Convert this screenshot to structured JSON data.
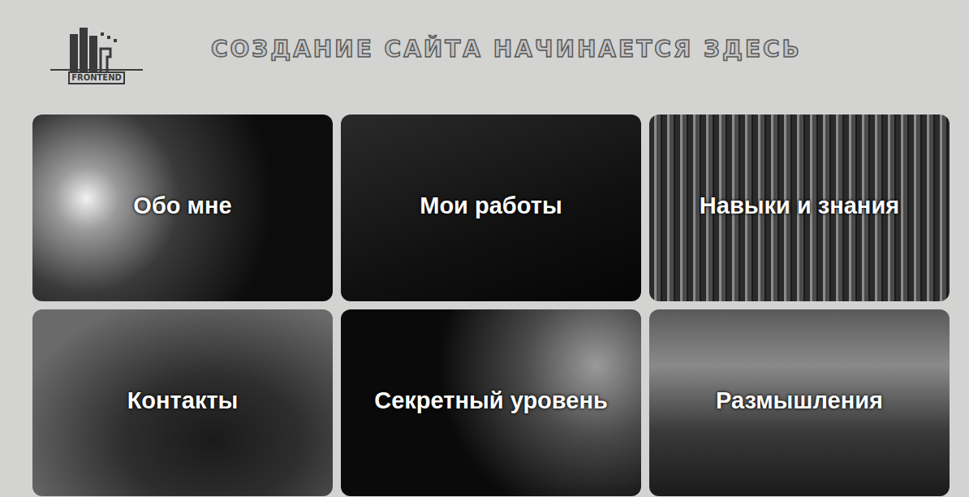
{
  "header": {
    "logo_text": "FRONTEND",
    "title": "СОЗДАНИЕ САЙТА НАЧИНАЕТСЯ ЗДЕСЬ"
  },
  "cards": [
    {
      "label": "Обо мне"
    },
    {
      "label": "Мои работы"
    },
    {
      "label": "Навыки и знания"
    },
    {
      "label": "Контакты"
    },
    {
      "label": "Секретный уровень"
    },
    {
      "label": "Размышления"
    }
  ]
}
